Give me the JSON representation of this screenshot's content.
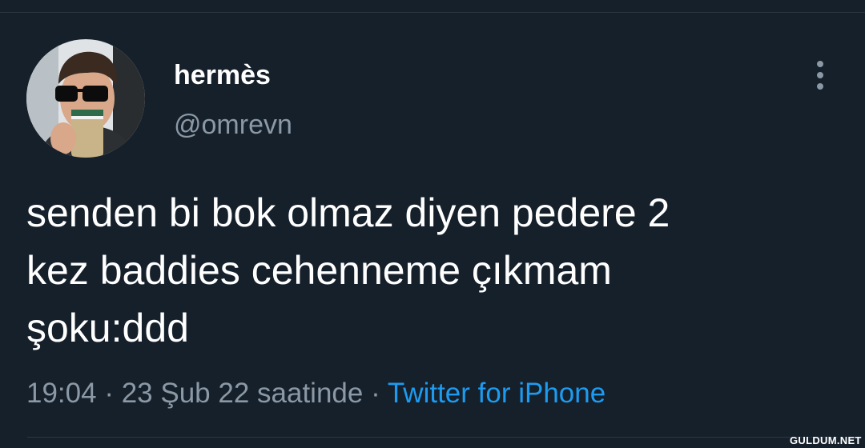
{
  "author": {
    "display_name": "hermès",
    "handle": "@omrevn"
  },
  "tweet": {
    "text": "senden bi bok olmaz diyen pedere 2\nkez baddies cehenneme çıkmam\nşoku:ddd",
    "time": "19:04",
    "separator": "·",
    "date": "23 Şub 22 saatinde",
    "source": "Twitter for iPhone"
  },
  "icons": {
    "more": "more-vertical-icon"
  },
  "watermark": "GULDUM.NET",
  "colors": {
    "background": "#15202b",
    "text": "#ffffff",
    "secondary_text": "#8b98a5",
    "link": "#1d9bf0"
  }
}
